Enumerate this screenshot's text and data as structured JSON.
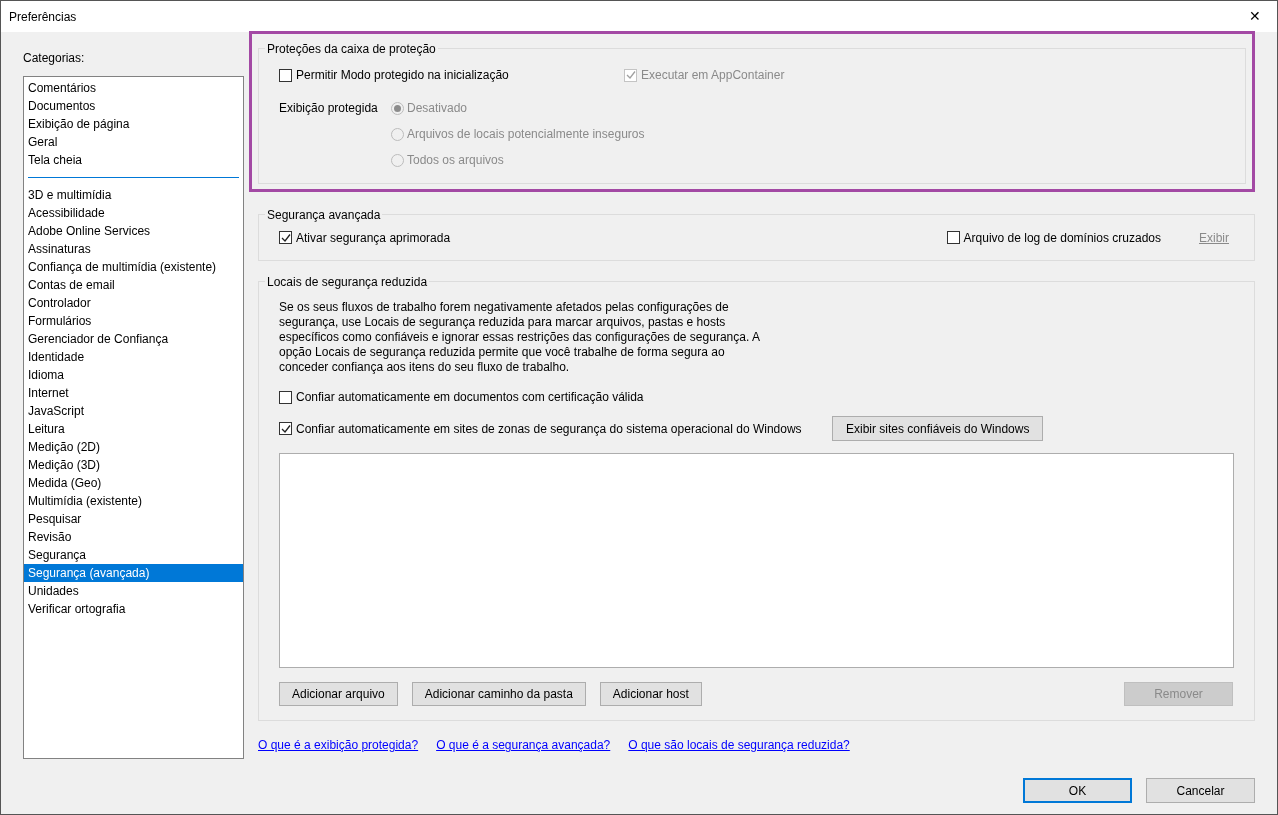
{
  "window": {
    "title": "Preferências",
    "close": "✕"
  },
  "categories": {
    "label": "Categorias:",
    "groups": [
      [
        {
          "label": "Comentários",
          "selected": false
        },
        {
          "label": "Documentos",
          "selected": false
        },
        {
          "label": "Exibição de página",
          "selected": false
        },
        {
          "label": "Geral",
          "selected": false
        },
        {
          "label": "Tela cheia",
          "selected": false
        }
      ],
      [
        {
          "label": "3D e multimídia",
          "selected": false
        },
        {
          "label": "Acessibilidade",
          "selected": false
        },
        {
          "label": "Adobe Online Services",
          "selected": false
        },
        {
          "label": "Assinaturas",
          "selected": false
        },
        {
          "label": "Confiança de multimídia (existente)",
          "selected": false
        },
        {
          "label": "Contas de email",
          "selected": false
        },
        {
          "label": "Controlador",
          "selected": false
        },
        {
          "label": "Formulários",
          "selected": false
        },
        {
          "label": "Gerenciador de Confiança",
          "selected": false
        },
        {
          "label": "Identidade",
          "selected": false
        },
        {
          "label": "Idioma",
          "selected": false
        },
        {
          "label": "Internet",
          "selected": false
        },
        {
          "label": "JavaScript",
          "selected": false
        },
        {
          "label": "Leitura",
          "selected": false
        },
        {
          "label": "Medição (2D)",
          "selected": false
        },
        {
          "label": "Medição (3D)",
          "selected": false
        },
        {
          "label": "Medida (Geo)",
          "selected": false
        },
        {
          "label": "Multimídia (existente)",
          "selected": false
        },
        {
          "label": "Pesquisar",
          "selected": false
        },
        {
          "label": "Revisão",
          "selected": false
        },
        {
          "label": "Segurança",
          "selected": false
        },
        {
          "label": "Segurança (avançada)",
          "selected": true
        },
        {
          "label": "Unidades",
          "selected": false
        },
        {
          "label": "Verificar ortografia",
          "selected": false
        }
      ]
    ]
  },
  "sandbox": {
    "title": "Proteções da caixa de proteção",
    "highlighted": true,
    "protected_mode": {
      "label": "Permitir Modo protegido na inicialização",
      "checked": false,
      "disabled": false
    },
    "app_container": {
      "label": "Executar em AppContainer",
      "checked": true,
      "disabled": true
    },
    "protected_view": {
      "label": "Exibição protegida",
      "disabled": true,
      "options": [
        {
          "label": "Desativado",
          "selected": true
        },
        {
          "label": "Arquivos de locais potencialmente inseguros",
          "selected": false
        },
        {
          "label": "Todos os arquivos",
          "selected": false
        }
      ]
    }
  },
  "enhanced": {
    "title": "Segurança avançada",
    "enable": {
      "label": "Ativar segurança aprimorada",
      "checked": true,
      "disabled": false
    },
    "cross_domain_log": {
      "label": "Arquivo de log de domínios cruzados",
      "checked": false,
      "disabled": false
    },
    "view_link": {
      "label": "Exibir",
      "disabled": true
    }
  },
  "privileged": {
    "title": "Locais de segurança reduzida",
    "description": "Se os seus fluxos de trabalho forem negativamente afetados pelas configurações de segurança, use Locais de segurança reduzida para marcar arquivos, pastas e hosts específicos como confiáveis e ignorar essas restrições das configurações de segurança. A opção Locais de segurança reduzida permite que você trabalhe de forma segura ao conceder confiança aos itens do seu fluxo de trabalho.",
    "certified": {
      "label": "Confiar automaticamente em documentos com certificação válida",
      "checked": false,
      "disabled": false
    },
    "windows_zones": {
      "label": "Confiar automaticamente em sites de zonas de segurança do sistema operacional do Windows",
      "checked": true,
      "disabled": false
    },
    "windows_button": {
      "label": "Exibir sites confiáveis do Windows",
      "disabled": false
    },
    "buttons": [
      {
        "label": "Adicionar arquivo",
        "disabled": false
      },
      {
        "label": "Adicionar caminho da pasta",
        "disabled": false
      },
      {
        "label": "Adicionar host",
        "disabled": false
      },
      {
        "label": "Remover",
        "disabled": true
      }
    ]
  },
  "links": [
    "O que é a exibição protegida?",
    "O que é a segurança avançada?",
    "O que são locais de segurança reduzida?"
  ],
  "footer": [
    {
      "label": "OK",
      "default": true
    },
    {
      "label": "Cancelar",
      "default": false
    }
  ]
}
